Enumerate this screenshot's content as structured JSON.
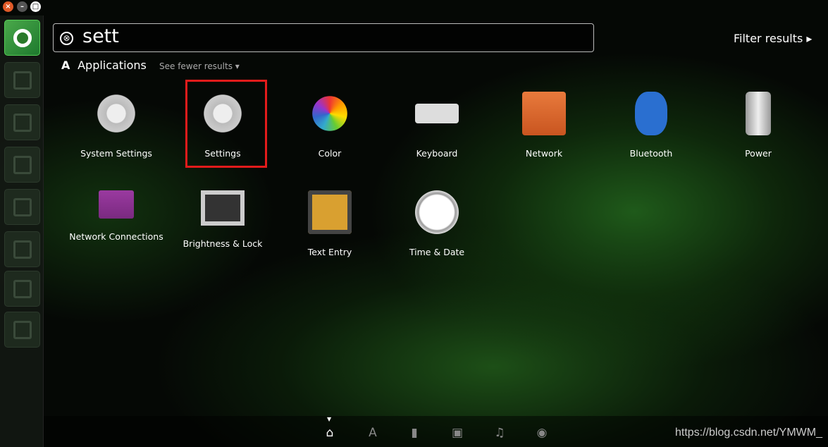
{
  "window": {
    "close": "×",
    "minimize": "–",
    "maximize": "□"
  },
  "search": {
    "query": "sett",
    "clear_icon": "⊗"
  },
  "filter_label": "Filter results ▸",
  "category": {
    "icon": "A",
    "title": "Applications",
    "toggle": "See fewer results ▾"
  },
  "apps": [
    {
      "label": "System Settings",
      "icon": "gear-wrench-icon"
    },
    {
      "label": "Settings",
      "icon": "gear-wrench-icon",
      "highlighted": true
    },
    {
      "label": "Color",
      "icon": "color-flower-icon"
    },
    {
      "label": "Keyboard",
      "icon": "keyboard-icon"
    },
    {
      "label": "Network",
      "icon": "network-folder-icon"
    },
    {
      "label": "Bluetooth",
      "icon": "bluetooth-icon"
    },
    {
      "label": "Power",
      "icon": "battery-icon"
    },
    {
      "label": "Network Connections",
      "icon": "network-connections-icon"
    },
    {
      "label": "Brightness & Lock",
      "icon": "lock-monitor-icon"
    },
    {
      "label": "Text Entry",
      "icon": "text-entry-icon"
    },
    {
      "label": "Time & Date",
      "icon": "clock-icon"
    }
  ],
  "lenses": [
    "home-icon",
    "applications-icon",
    "files-icon",
    "video-icon",
    "music-icon",
    "photo-icon"
  ],
  "watermark": "https://blog.csdn.net/YMWM_",
  "colors": {
    "highlight": "#e21b1b",
    "launcher_home": "#3a9a3a"
  }
}
